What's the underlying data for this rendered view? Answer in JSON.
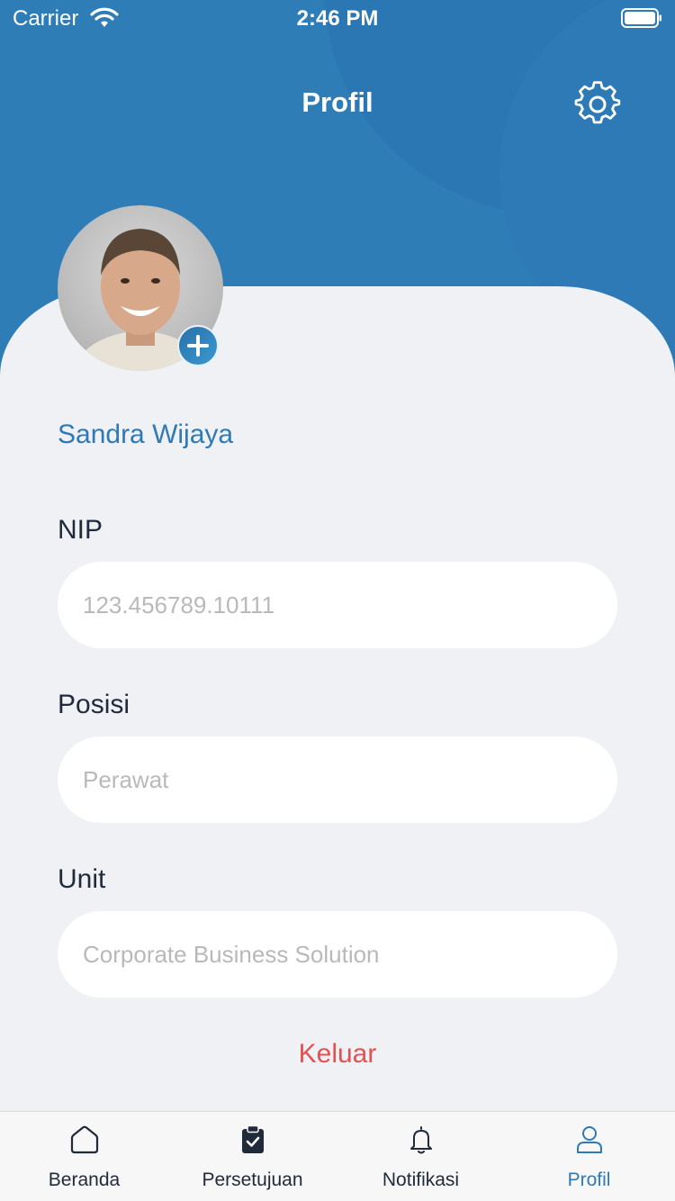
{
  "status_bar": {
    "carrier": "Carrier",
    "time": "2:46 PM",
    "wifi_icon": "wifi-icon",
    "battery_icon": "battery-icon"
  },
  "header": {
    "title": "Profil",
    "settings_icon": "gear-icon",
    "background_color": "#2f7db7"
  },
  "profile": {
    "name": "Sandra Wijaya",
    "avatar_icon": "avatar",
    "add_photo_icon": "plus-icon",
    "name_color": "#2f79b4"
  },
  "fields": {
    "nip": {
      "label": "NIP",
      "value": "123.456789.10111"
    },
    "posisi": {
      "label": "Posisi",
      "value": "Perawat"
    },
    "unit": {
      "label": "Unit",
      "value": "Corporate Business Solution"
    }
  },
  "logout": {
    "label": "Keluar",
    "color": "#e35252"
  },
  "bottom_nav": {
    "items": [
      {
        "label": "Beranda",
        "icon": "home-icon",
        "active": false
      },
      {
        "label": "Persetujuan",
        "icon": "clipboard-check-icon",
        "active": false
      },
      {
        "label": "Notifikasi",
        "icon": "bell-icon",
        "active": false
      },
      {
        "label": "Profil",
        "icon": "user-icon",
        "active": true
      }
    ],
    "active_color": "#2f79b4"
  }
}
